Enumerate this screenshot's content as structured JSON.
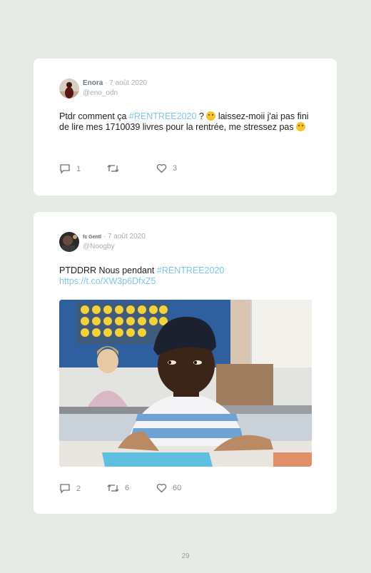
{
  "tweets": [
    {
      "name": "Enora",
      "date": "· 7 août 2020",
      "handle": "@eno_odn",
      "text_pre": "Ptdr comment ça ",
      "hashtag": "#RENTREE2020",
      "text_mid": " ? ",
      "text_post": " laissez-moii j'ai pas fini de lire mes 1710039 livres pour la rentrée, me stressez pas ",
      "emoji_icon": "crying-face-emoji",
      "replies": "1",
      "retweets": "",
      "likes": "3"
    },
    {
      "name": "fc Gentl",
      "date": "· 7 août 2020",
      "handle": "@Noogby",
      "text_pre": "PTDDRR Nous pendant ",
      "hashtag": "#RENTREE2020",
      "link": "https://t.co/XW3p6DfxZ5",
      "replies": "2",
      "retweets": "6",
      "likes": "60"
    }
  ],
  "page_number": "29",
  "colors": {
    "background": "#e7ebe6",
    "card": "#ffffff",
    "accent": "#7cc8e6"
  }
}
